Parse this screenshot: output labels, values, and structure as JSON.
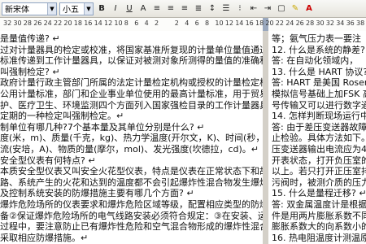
{
  "toolbar": {
    "font_name": "新宋体",
    "font_size": "小五",
    "bold": "B",
    "italic": "I",
    "underline": "U",
    "char_scale": "A",
    "font_color_a": "A"
  },
  "ruler": {
    "numbers": [
      "32",
      "30",
      "28",
      "26",
      "24",
      "22",
      "20",
      "18",
      "16",
      "14",
      "12",
      "10",
      "8",
      "6",
      "4",
      "2",
      "",
      "2",
      "4",
      "6",
      "8",
      "10",
      "12",
      "14",
      "16",
      "18",
      "20",
      "22",
      "24",
      "26",
      "28",
      "30",
      "32",
      "34",
      "36",
      "38"
    ]
  },
  "document": {
    "left_lines": [
      "是量值传递? ↵",
      "过对计量器具的检定或校准，将国家基准所复现的计量单位量值通过各等级计",
      "标准传递到工作计量器具，以保证对被测对象所测得的量值的准确和一致。↵",
      "叫强制检定? ↵",
      "政府计量行政主管部门所属的法定计量检定机构或授权的计量检定机构，对社",
      "公用计量标准，部门和企业事业单位使用的最高计量标准，用于贸易结算、安全",
      "护、医疗卫生、环境监测四个方面列入国家强检目录的工作计量器具，实行定",
      "定期的一种检定叫强制检定。↵",
      "制单位有哪几种?7个基本量及其单位分别是什么? ↵",
      "度(米，m)、质量(千克，kg)、热力学温度(开尔文，K)、时间(秒，s)、",
      "流(安培，A)、物质的量(摩尔，mol)、发光强度(坎德拉，cd)。↵",
      "安全型仪表有何特点? ↵",
      "本质安全型仪表又叫安全火花型仪表，特点是仪表在正常状态下和故障状态下，",
      "路、系统产生的火花和达到的温度都不会引起爆炸性混合物发生爆炸。↵",
      "及控制系统安装的防爆措施主要有哪几个方面? ↵",
      "爆炸危险场所的仪表要求和爆炸危险区域等级，配置相应类型的防爆仪表和电器设",
      "备②保证爆炸危险场所的电气线路安装必须符合规定：③在安装、运行、维护、检",
      "过程中，要注意防止已有爆炸性危险和空气混合物形成的爆炸性混合物，工作时，",
      "采取相应防爆措施。↵"
    ],
    "right_lines": [
      "等；氨气压力表一要注",
      "12. 什么是系统的静差? ↵",
      "答: 在自动化领域内，",
      "13. 什么是 HART 协议? ↵",
      "答: HART 是美国 Rosemount 公",
      "模拟信号基础上加FSK 高频信",
      "号传输又可以进行数字通信，",
      "14. 怎样判断现场运行中差压变送",
      "答: 由于差压变送器故障多是零点",
      "止检验。具体方法如下。↵",
      "压变送器输出电流应为4mA。",
      "开表状态，打开负压室的排污",
      "以上。若只打开正压室排污阀",
      "污阀时，被测介质的压力不变",
      "15. 什么是量程迁移? ↵",
      "答: 双金属温度计是根据长度随",
      "件是用两片膨胀系数不同的",
      "膨胀系数大的向系数小的一",
      "16. 热电阻温度计测温原理是什"
    ]
  }
}
